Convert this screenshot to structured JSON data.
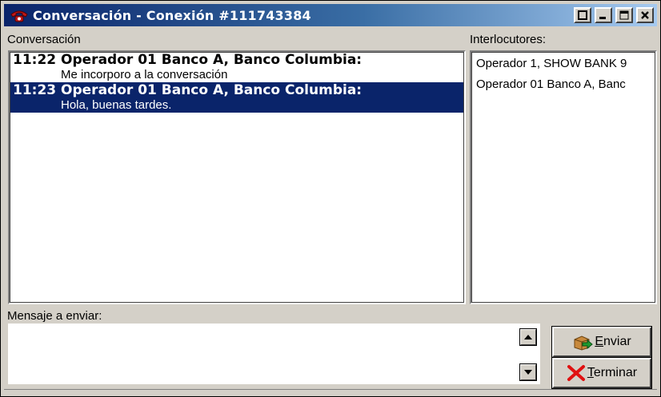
{
  "window": {
    "title": "Conversación - Conexión #111743384",
    "title_icon": "telephone-icon",
    "controls": [
      "restore-icon",
      "minimize-icon",
      "maximize-icon",
      "close-icon"
    ]
  },
  "conversation": {
    "label": "Conversación",
    "messages": [
      {
        "header": "11:22 Operador 01 Banco A, Banco Columbia:",
        "text": "Me incorporo a la conversación",
        "selected": false
      },
      {
        "header": "11:23 Operador 01 Banco A, Banco Columbia:",
        "text": "Hola, buenas tardes.",
        "selected": true
      }
    ]
  },
  "participants": {
    "label": "Interlocutores:",
    "items": [
      "Operador 1, SHOW BANK 9",
      "Operador 01 Banco A, Banc"
    ]
  },
  "compose": {
    "label": "Mensaje a enviar:",
    "value": ""
  },
  "buttons": {
    "send_accel": "E",
    "send_rest": "nviar",
    "end_accel": "T",
    "end_rest": "erminar"
  },
  "colors": {
    "selection": "#0a246a",
    "face": "#d4d0c8",
    "title_start": "#0a246a",
    "title_end": "#a6caf0"
  }
}
